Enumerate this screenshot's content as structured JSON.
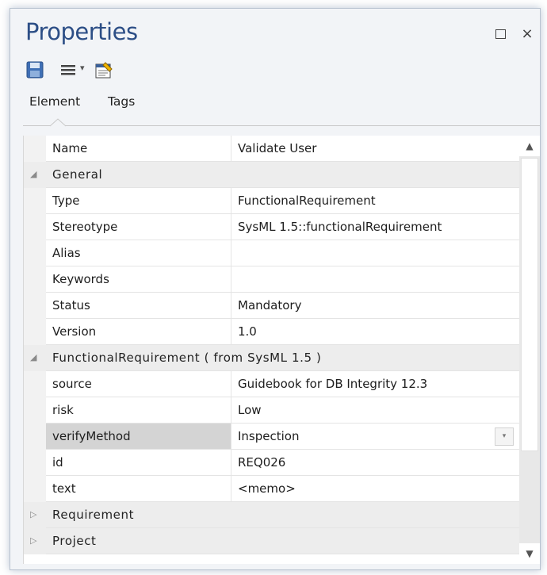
{
  "window": {
    "title": "Properties",
    "restore_icon": "restore-icon",
    "close_glyph": "×"
  },
  "toolbar": {
    "save_icon": "save-icon",
    "menu_icon": "menu-icon",
    "dropdown_glyph": "▾",
    "properties_icon": "element-properties-icon"
  },
  "tabs": [
    {
      "label": "Element",
      "active": true
    },
    {
      "label": "Tags",
      "active": false
    }
  ],
  "grid": {
    "rows": [
      {
        "kind": "prop",
        "name": "Name",
        "value": "Validate User"
      },
      {
        "kind": "group",
        "name": "General",
        "expanded": true
      },
      {
        "kind": "prop",
        "name": "Type",
        "value": "FunctionalRequirement"
      },
      {
        "kind": "prop",
        "name": "Stereotype",
        "value": "SysML 1.5::functionalRequirement"
      },
      {
        "kind": "prop",
        "name": "Alias",
        "value": ""
      },
      {
        "kind": "prop",
        "name": "Keywords",
        "value": ""
      },
      {
        "kind": "prop",
        "name": "Status",
        "value": "Mandatory"
      },
      {
        "kind": "prop",
        "name": "Version",
        "value": "1.0"
      },
      {
        "kind": "group",
        "name": "FunctionalRequirement  ( from SysML 1.5 )",
        "expanded": true
      },
      {
        "kind": "prop",
        "name": "source",
        "value": "Guidebook for DB Integrity 12.3"
      },
      {
        "kind": "prop",
        "name": "risk",
        "value": "Low"
      },
      {
        "kind": "prop",
        "name": "verifyMethod",
        "value": "Inspection",
        "selected": true,
        "dropdown": true
      },
      {
        "kind": "prop",
        "name": "id",
        "value": "REQ026"
      },
      {
        "kind": "prop",
        "name": "text",
        "value": "<memo>"
      },
      {
        "kind": "group",
        "name": "Requirement",
        "expanded": false
      },
      {
        "kind": "group",
        "name": "Project",
        "expanded": false
      }
    ],
    "expanded_caret": "◢",
    "collapsed_caret": "▷"
  },
  "scrollbar": {
    "up_glyph": "▲",
    "down_glyph": "▼"
  },
  "colors": {
    "title": "#2c4e86",
    "selected_name_bg": "#d4d4d4",
    "group_bg": "#ededed"
  }
}
